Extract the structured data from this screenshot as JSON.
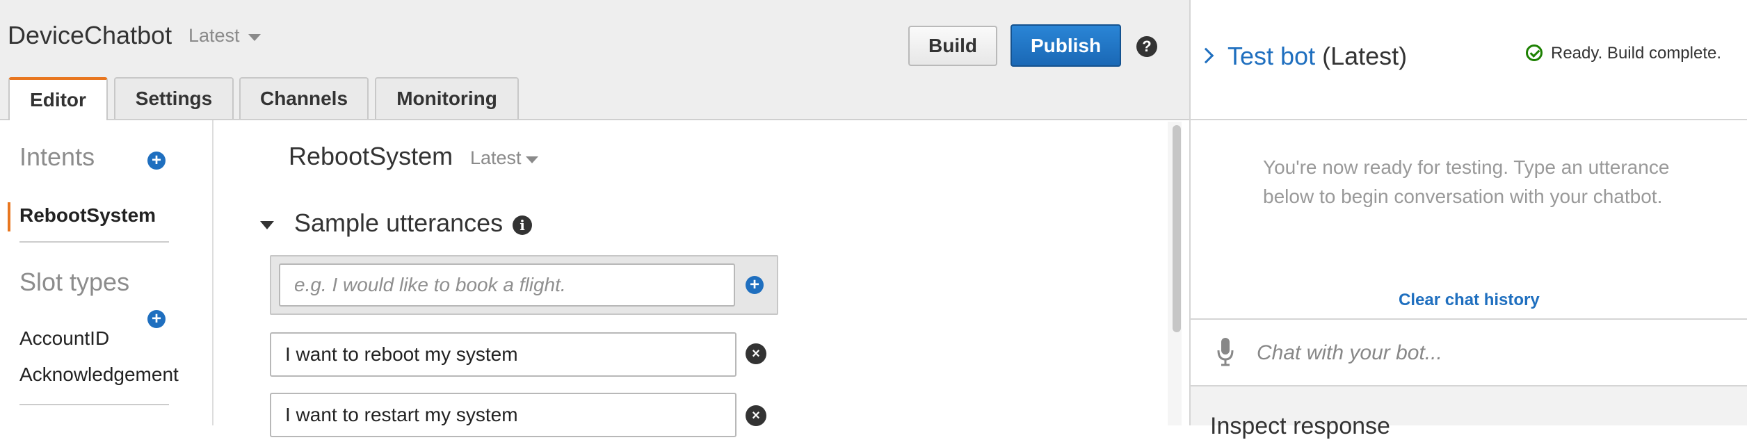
{
  "header": {
    "bot_name": "DeviceChatbot",
    "version": "Latest",
    "build_label": "Build",
    "publish_label": "Publish",
    "help_symbol": "?"
  },
  "tabs": [
    {
      "label": "Editor",
      "active": true
    },
    {
      "label": "Settings",
      "active": false
    },
    {
      "label": "Channels",
      "active": false
    },
    {
      "label": "Monitoring",
      "active": false
    }
  ],
  "sidebar": {
    "intents_heading": "Intents",
    "intents": [
      "RebootSystem"
    ],
    "slot_types_heading": "Slot types",
    "slot_types": [
      "AccountID",
      "Acknowledgement"
    ]
  },
  "intent": {
    "name": "RebootSystem",
    "version": "Latest",
    "section_title": "Sample utterances",
    "utterance_placeholder": "e.g. I would like to book a flight.",
    "utterances": [
      "I want to reboot my system",
      "I want to restart my system"
    ]
  },
  "test_bot": {
    "title": "Test bot",
    "version": "(Latest)",
    "status": "Ready. Build complete.",
    "ready_message": "You're now ready for testing. Type an utterance below to begin conversation with your chatbot.",
    "clear_history": "Clear chat history",
    "chat_placeholder": "Chat with your bot...",
    "inspect_title": "Inspect response"
  },
  "colors": {
    "accent": "#1f6fbf",
    "tab_active": "#e8761f",
    "success": "#1d8102"
  }
}
